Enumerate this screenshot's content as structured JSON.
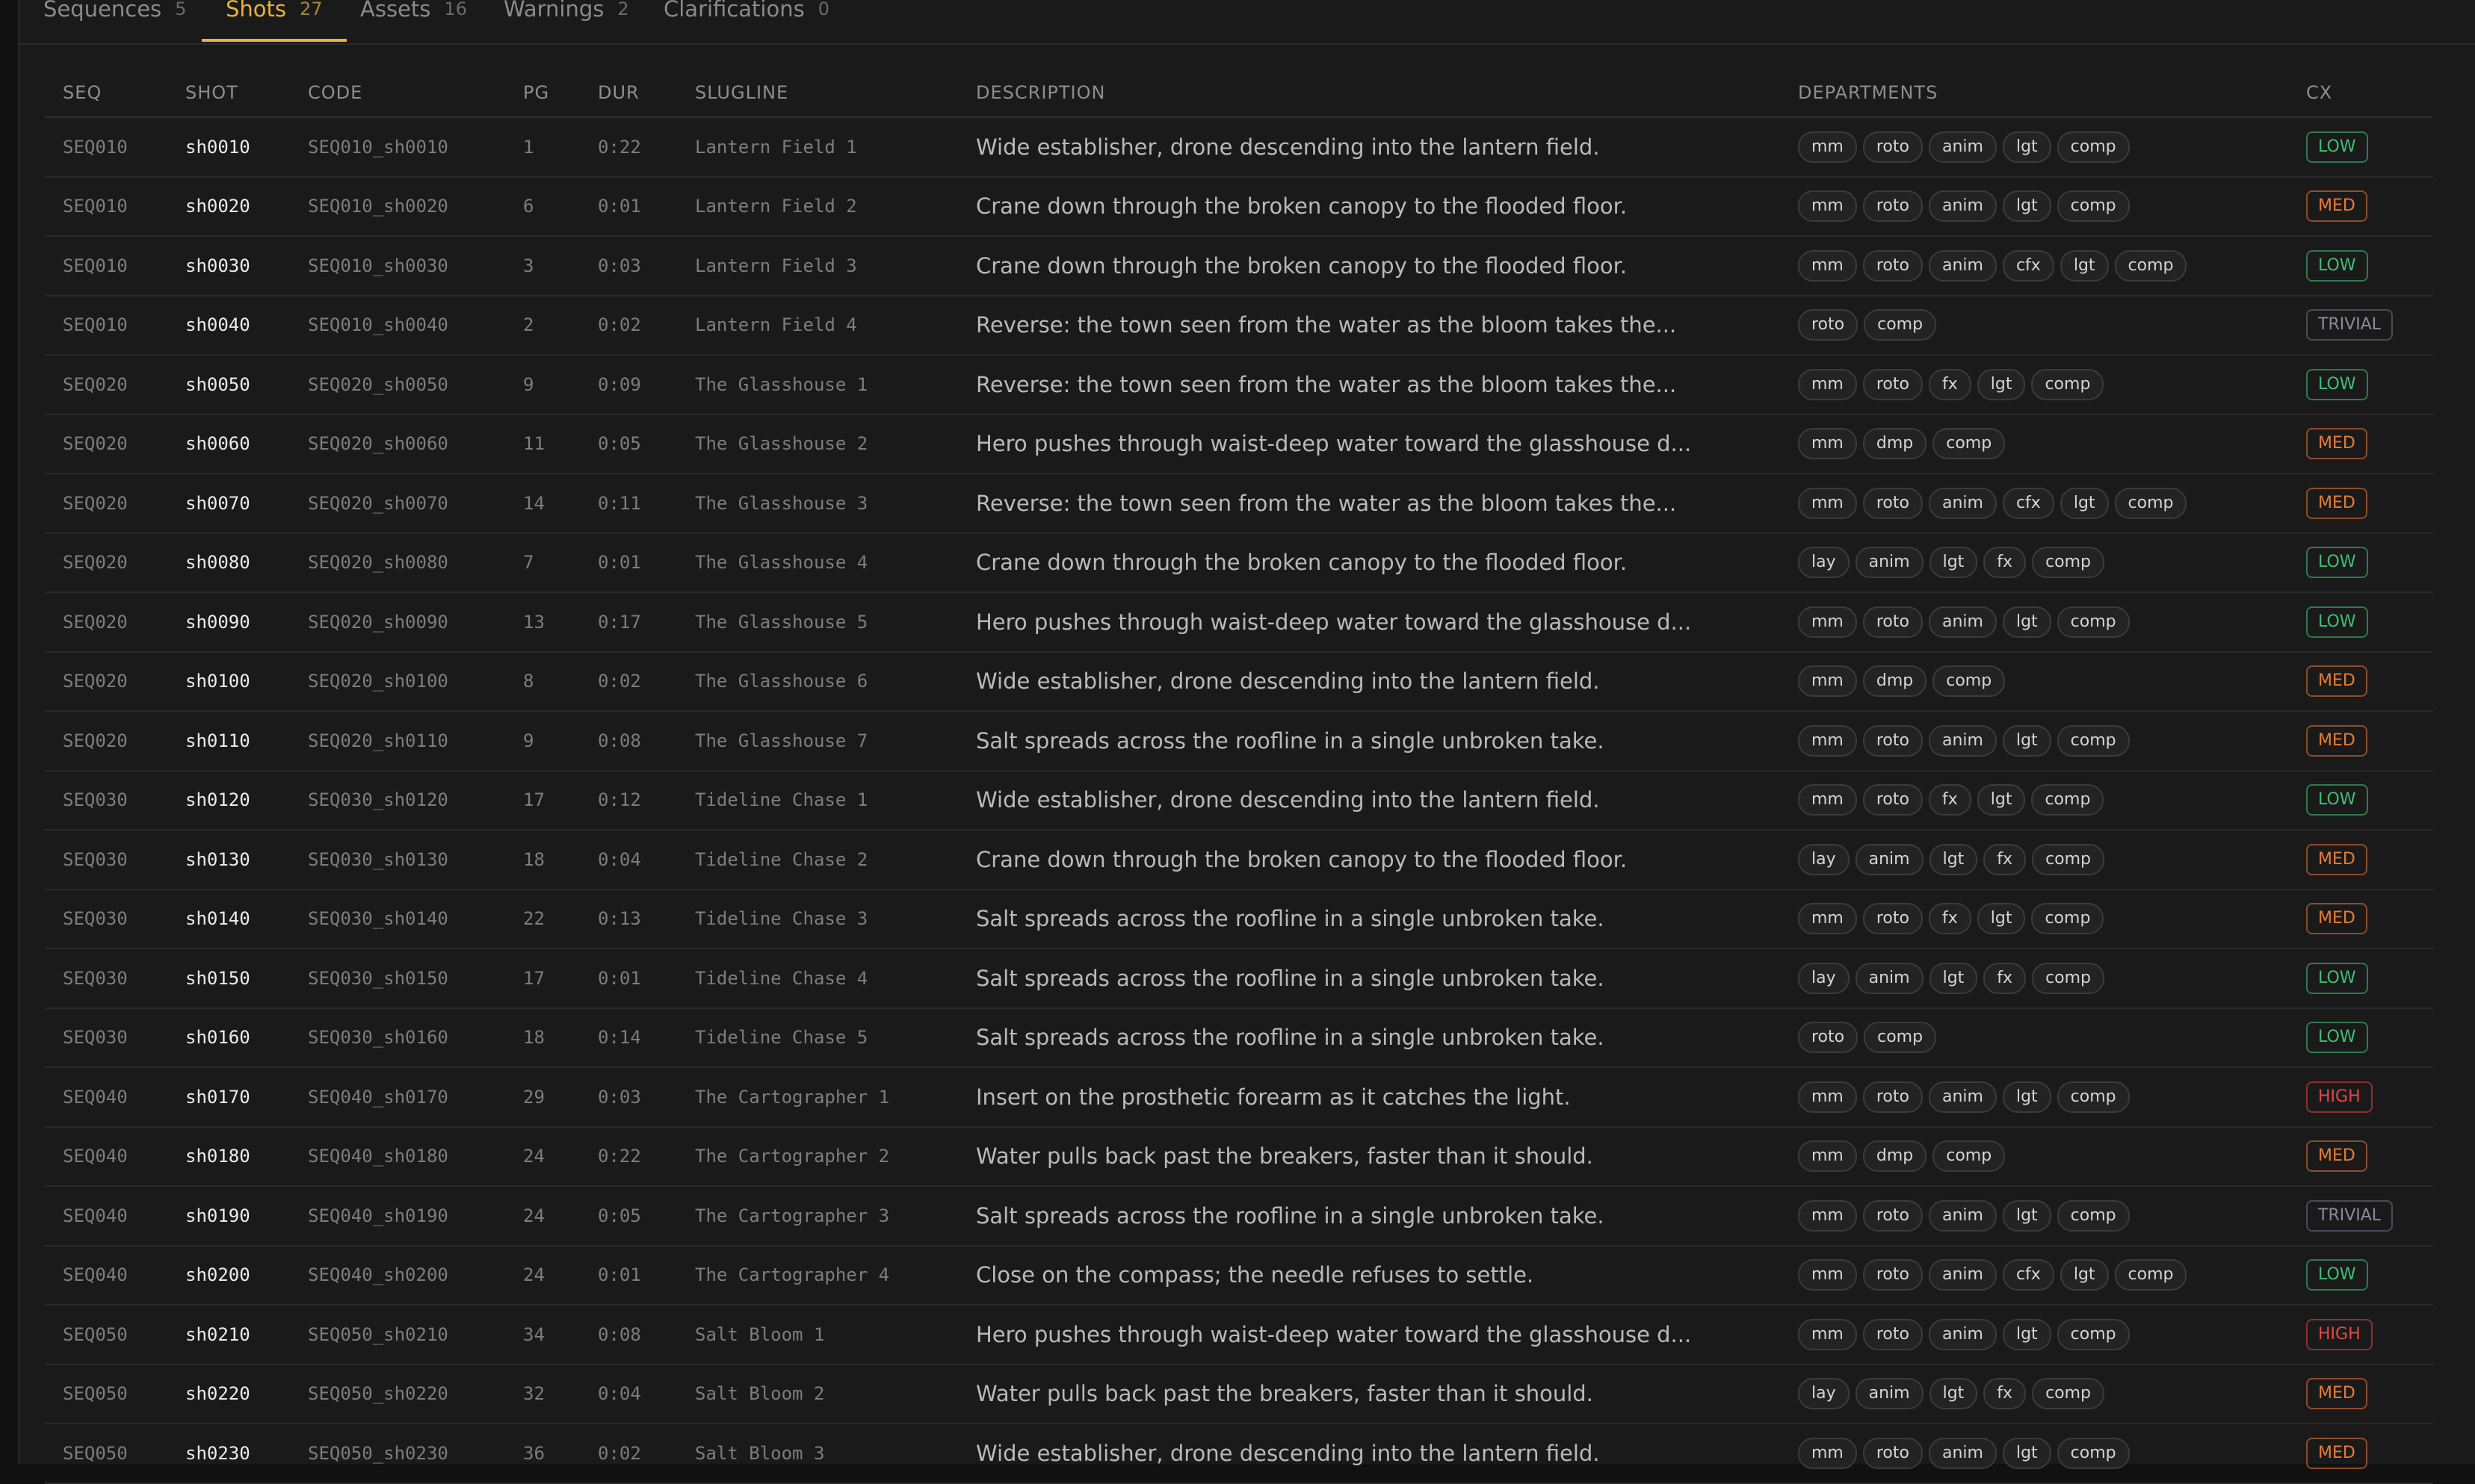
{
  "tabs": [
    {
      "label": "Sequences",
      "count": "5",
      "active": false
    },
    {
      "label": "Shots",
      "count": "27",
      "active": true
    },
    {
      "label": "Assets",
      "count": "16",
      "active": false
    },
    {
      "label": "Warnings",
      "count": "2",
      "active": false
    },
    {
      "label": "Clarifications",
      "count": "0",
      "active": false
    }
  ],
  "columns": [
    "SEQ",
    "SHOT",
    "CODE",
    "PG",
    "DUR",
    "SLUGLINE",
    "DESCRIPTION",
    "DEPARTMENTS",
    "CX"
  ],
  "rows": [
    {
      "seq": "SEQ010",
      "shot": "sh0010",
      "code": "SEQ010_sh0010",
      "pg": "1",
      "dur": "0:22",
      "slug": "Lantern Field 1",
      "desc": "Wide establisher, drone descending into the lantern field.",
      "depts": [
        "mm",
        "roto",
        "anim",
        "lgt",
        "comp"
      ],
      "cx": "LOW"
    },
    {
      "seq": "SEQ010",
      "shot": "sh0020",
      "code": "SEQ010_sh0020",
      "pg": "6",
      "dur": "0:01",
      "slug": "Lantern Field 2",
      "desc": "Crane down through the broken canopy to the flooded floor.",
      "depts": [
        "mm",
        "roto",
        "anim",
        "lgt",
        "comp"
      ],
      "cx": "MED"
    },
    {
      "seq": "SEQ010",
      "shot": "sh0030",
      "code": "SEQ010_sh0030",
      "pg": "3",
      "dur": "0:03",
      "slug": "Lantern Field 3",
      "desc": "Crane down through the broken canopy to the flooded floor.",
      "depts": [
        "mm",
        "roto",
        "anim",
        "cfx",
        "lgt",
        "comp"
      ],
      "cx": "LOW"
    },
    {
      "seq": "SEQ010",
      "shot": "sh0040",
      "code": "SEQ010_sh0040",
      "pg": "2",
      "dur": "0:02",
      "slug": "Lantern Field 4",
      "desc": "Reverse: the town seen from the water as the bloom takes the...",
      "depts": [
        "roto",
        "comp"
      ],
      "cx": "TRIVIAL"
    },
    {
      "seq": "SEQ020",
      "shot": "sh0050",
      "code": "SEQ020_sh0050",
      "pg": "9",
      "dur": "0:09",
      "slug": "The Glasshouse 1",
      "desc": "Reverse: the town seen from the water as the bloom takes the...",
      "depts": [
        "mm",
        "roto",
        "fx",
        "lgt",
        "comp"
      ],
      "cx": "LOW"
    },
    {
      "seq": "SEQ020",
      "shot": "sh0060",
      "code": "SEQ020_sh0060",
      "pg": "11",
      "dur": "0:05",
      "slug": "The Glasshouse 2",
      "desc": "Hero pushes through waist-deep water toward the glasshouse d...",
      "depts": [
        "mm",
        "dmp",
        "comp"
      ],
      "cx": "MED"
    },
    {
      "seq": "SEQ020",
      "shot": "sh0070",
      "code": "SEQ020_sh0070",
      "pg": "14",
      "dur": "0:11",
      "slug": "The Glasshouse 3",
      "desc": "Reverse: the town seen from the water as the bloom takes the...",
      "depts": [
        "mm",
        "roto",
        "anim",
        "cfx",
        "lgt",
        "comp"
      ],
      "cx": "MED"
    },
    {
      "seq": "SEQ020",
      "shot": "sh0080",
      "code": "SEQ020_sh0080",
      "pg": "7",
      "dur": "0:01",
      "slug": "The Glasshouse 4",
      "desc": "Crane down through the broken canopy to the flooded floor.",
      "depts": [
        "lay",
        "anim",
        "lgt",
        "fx",
        "comp"
      ],
      "cx": "LOW"
    },
    {
      "seq": "SEQ020",
      "shot": "sh0090",
      "code": "SEQ020_sh0090",
      "pg": "13",
      "dur": "0:17",
      "slug": "The Glasshouse 5",
      "desc": "Hero pushes through waist-deep water toward the glasshouse d...",
      "depts": [
        "mm",
        "roto",
        "anim",
        "lgt",
        "comp"
      ],
      "cx": "LOW"
    },
    {
      "seq": "SEQ020",
      "shot": "sh0100",
      "code": "SEQ020_sh0100",
      "pg": "8",
      "dur": "0:02",
      "slug": "The Glasshouse 6",
      "desc": "Wide establisher, drone descending into the lantern field.",
      "depts": [
        "mm",
        "dmp",
        "comp"
      ],
      "cx": "MED"
    },
    {
      "seq": "SEQ020",
      "shot": "sh0110",
      "code": "SEQ020_sh0110",
      "pg": "9",
      "dur": "0:08",
      "slug": "The Glasshouse 7",
      "desc": "Salt spreads across the roofline in a single unbroken take.",
      "depts": [
        "mm",
        "roto",
        "anim",
        "lgt",
        "comp"
      ],
      "cx": "MED"
    },
    {
      "seq": "SEQ030",
      "shot": "sh0120",
      "code": "SEQ030_sh0120",
      "pg": "17",
      "dur": "0:12",
      "slug": "Tideline Chase 1",
      "desc": "Wide establisher, drone descending into the lantern field.",
      "depts": [
        "mm",
        "roto",
        "fx",
        "lgt",
        "comp"
      ],
      "cx": "LOW"
    },
    {
      "seq": "SEQ030",
      "shot": "sh0130",
      "code": "SEQ030_sh0130",
      "pg": "18",
      "dur": "0:04",
      "slug": "Tideline Chase 2",
      "desc": "Crane down through the broken canopy to the flooded floor.",
      "depts": [
        "lay",
        "anim",
        "lgt",
        "fx",
        "comp"
      ],
      "cx": "MED"
    },
    {
      "seq": "SEQ030",
      "shot": "sh0140",
      "code": "SEQ030_sh0140",
      "pg": "22",
      "dur": "0:13",
      "slug": "Tideline Chase 3",
      "desc": "Salt spreads across the roofline in a single unbroken take.",
      "depts": [
        "mm",
        "roto",
        "fx",
        "lgt",
        "comp"
      ],
      "cx": "MED"
    },
    {
      "seq": "SEQ030",
      "shot": "sh0150",
      "code": "SEQ030_sh0150",
      "pg": "17",
      "dur": "0:01",
      "slug": "Tideline Chase 4",
      "desc": "Salt spreads across the roofline in a single unbroken take.",
      "depts": [
        "lay",
        "anim",
        "lgt",
        "fx",
        "comp"
      ],
      "cx": "LOW"
    },
    {
      "seq": "SEQ030",
      "shot": "sh0160",
      "code": "SEQ030_sh0160",
      "pg": "18",
      "dur": "0:14",
      "slug": "Tideline Chase 5",
      "desc": "Salt spreads across the roofline in a single unbroken take.",
      "depts": [
        "roto",
        "comp"
      ],
      "cx": "LOW"
    },
    {
      "seq": "SEQ040",
      "shot": "sh0170",
      "code": "SEQ040_sh0170",
      "pg": "29",
      "dur": "0:03",
      "slug": "The Cartographer 1",
      "desc": "Insert on the prosthetic forearm as it catches the light.",
      "depts": [
        "mm",
        "roto",
        "anim",
        "lgt",
        "comp"
      ],
      "cx": "HIGH"
    },
    {
      "seq": "SEQ040",
      "shot": "sh0180",
      "code": "SEQ040_sh0180",
      "pg": "24",
      "dur": "0:22",
      "slug": "The Cartographer 2",
      "desc": "Water pulls back past the breakers, faster than it should.",
      "depts": [
        "mm",
        "dmp",
        "comp"
      ],
      "cx": "MED"
    },
    {
      "seq": "SEQ040",
      "shot": "sh0190",
      "code": "SEQ040_sh0190",
      "pg": "24",
      "dur": "0:05",
      "slug": "The Cartographer 3",
      "desc": "Salt spreads across the roofline in a single unbroken take.",
      "depts": [
        "mm",
        "roto",
        "anim",
        "lgt",
        "comp"
      ],
      "cx": "TRIVIAL"
    },
    {
      "seq": "SEQ040",
      "shot": "sh0200",
      "code": "SEQ040_sh0200",
      "pg": "24",
      "dur": "0:01",
      "slug": "The Cartographer 4",
      "desc": "Close on the compass; the needle refuses to settle.",
      "depts": [
        "mm",
        "roto",
        "anim",
        "cfx",
        "lgt",
        "comp"
      ],
      "cx": "LOW"
    },
    {
      "seq": "SEQ050",
      "shot": "sh0210",
      "code": "SEQ050_sh0210",
      "pg": "34",
      "dur": "0:08",
      "slug": "Salt Bloom 1",
      "desc": "Hero pushes through waist-deep water toward the glasshouse d...",
      "depts": [
        "mm",
        "roto",
        "anim",
        "lgt",
        "comp"
      ],
      "cx": "HIGH"
    },
    {
      "seq": "SEQ050",
      "shot": "sh0220",
      "code": "SEQ050_sh0220",
      "pg": "32",
      "dur": "0:04",
      "slug": "Salt Bloom 2",
      "desc": "Water pulls back past the breakers, faster than it should.",
      "depts": [
        "lay",
        "anim",
        "lgt",
        "fx",
        "comp"
      ],
      "cx": "MED"
    },
    {
      "seq": "SEQ050",
      "shot": "sh0230",
      "code": "SEQ050_sh0230",
      "pg": "36",
      "dur": "0:02",
      "slug": "Salt Bloom 3",
      "desc": "Wide establisher, drone descending into the lantern field.",
      "depts": [
        "mm",
        "roto",
        "anim",
        "lgt",
        "comp"
      ],
      "cx": "MED"
    }
  ]
}
